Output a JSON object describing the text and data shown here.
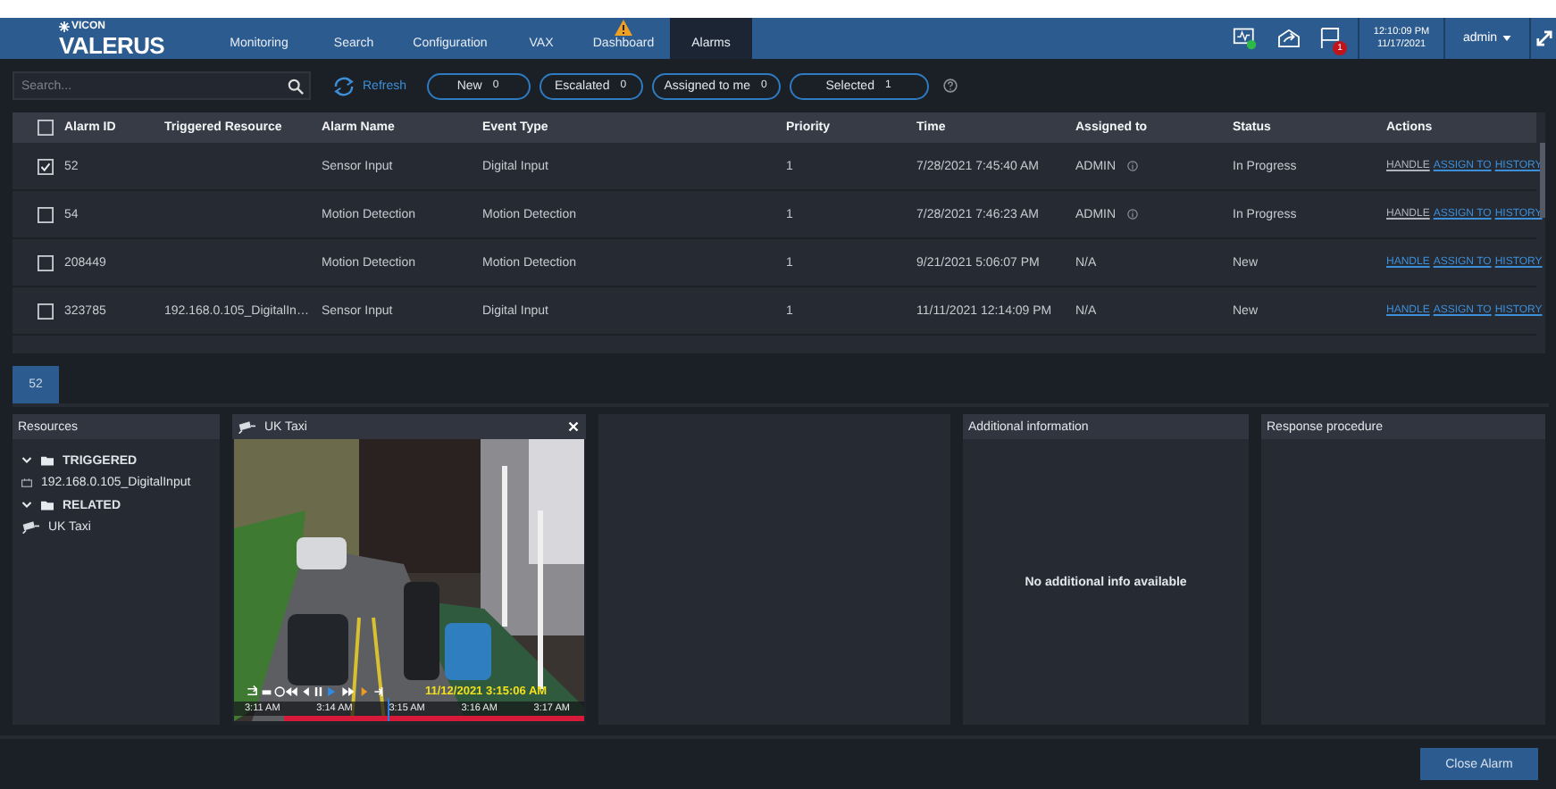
{
  "header": {
    "brand": "VICON",
    "product": "VALERUS",
    "nav": [
      {
        "label": "Monitoring",
        "selected": false,
        "warning": false
      },
      {
        "label": "Search",
        "selected": false,
        "warning": false
      },
      {
        "label": "Configuration",
        "selected": false,
        "warning": false
      },
      {
        "label": "VAX",
        "selected": false,
        "warning": false
      },
      {
        "label": "Dashboard",
        "selected": false,
        "warning": true
      },
      {
        "label": "Alarms",
        "selected": true,
        "warning": false
      }
    ],
    "flag_badge": "1",
    "time": "12:10:09 PM",
    "date": "11/17/2021",
    "user": "admin"
  },
  "toolbar": {
    "search": {
      "placeholder": "Search..."
    },
    "refresh": "Refresh",
    "filters": [
      {
        "label": "New",
        "count": "0"
      },
      {
        "label": "Escalated",
        "count": "0"
      },
      {
        "label": "Assigned to me",
        "count": "0"
      },
      {
        "label": "Selected",
        "count": "1"
      }
    ]
  },
  "table": {
    "all_checked": false,
    "columns": [
      "Alarm ID",
      "Triggered Resource",
      "Alarm Name",
      "Event Type",
      "Priority",
      "Time",
      "Assigned to",
      "Status",
      "Actions"
    ],
    "rows": [
      {
        "checked": true,
        "alarm_id": "52",
        "triggered_resource": "",
        "alarm_name": "Sensor Input",
        "event_type": "Digital Input",
        "priority": "1",
        "time": "7/28/2021 7:45:40 AM",
        "assigned_to": "ADMIN",
        "assigned_info": true,
        "status": "In Progress",
        "actions": [
          {
            "label": "HANDLE",
            "kind": "handle"
          },
          {
            "label": "ASSIGN TO",
            "kind": "link"
          },
          {
            "label": "HISTORY",
            "kind": "link"
          }
        ]
      },
      {
        "checked": false,
        "alarm_id": "54",
        "triggered_resource": "",
        "alarm_name": "Motion Detection",
        "event_type": "Motion Detection",
        "priority": "1",
        "time": "7/28/2021 7:46:23 AM",
        "assigned_to": "ADMIN",
        "assigned_info": true,
        "status": "In Progress",
        "actions": [
          {
            "label": "HANDLE",
            "kind": "handle"
          },
          {
            "label": "ASSIGN TO",
            "kind": "link"
          },
          {
            "label": "HISTORY",
            "kind": "link"
          }
        ]
      },
      {
        "checked": false,
        "alarm_id": "208449",
        "triggered_resource": "",
        "alarm_name": "Motion Detection",
        "event_type": "Motion Detection",
        "priority": "1",
        "time": "9/21/2021 5:06:07 PM",
        "assigned_to": "N/A",
        "assigned_info": false,
        "status": "New",
        "actions": [
          {
            "label": "HANDLE",
            "kind": "link"
          },
          {
            "label": "ASSIGN TO",
            "kind": "link"
          },
          {
            "label": "HISTORY",
            "kind": "link"
          }
        ]
      },
      {
        "checked": false,
        "alarm_id": "323785",
        "triggered_resource": "192.168.0.105_DigitalIn…",
        "alarm_name": "Sensor Input",
        "event_type": "Digital Input",
        "priority": "1",
        "time": "11/11/2021 12:14:09 PM",
        "assigned_to": "N/A",
        "assigned_info": false,
        "status": "New",
        "actions": [
          {
            "label": "HANDLE",
            "kind": "link"
          },
          {
            "label": "ASSIGN TO",
            "kind": "link"
          },
          {
            "label": "HISTORY",
            "kind": "link"
          }
        ]
      }
    ]
  },
  "detail": {
    "tabs": [
      {
        "label": "52",
        "selected": true
      }
    ],
    "resources": {
      "title": "Resources",
      "tree": [
        {
          "label": "TRIGGERED",
          "kind": "folder",
          "expanded": true,
          "children": [
            {
              "label": "192.168.0.105_DigitalInput",
              "kind": "input"
            }
          ]
        },
        {
          "label": "RELATED",
          "kind": "folder",
          "expanded": true,
          "children": [
            {
              "label": "UK Taxi",
              "kind": "camera"
            }
          ]
        }
      ]
    },
    "video": {
      "title": "UK Taxi",
      "timestamp": "11/12/2021 3:15:06 AM",
      "timeline": [
        "3:11 AM",
        "3:14 AM",
        "3:15 AM",
        "3:16 AM",
        "3:17 AM"
      ]
    },
    "additional": {
      "title": "Additional information",
      "message": "No additional info available"
    },
    "response": {
      "title": "Response procedure"
    }
  },
  "footer": {
    "close": "Close Alarm"
  }
}
